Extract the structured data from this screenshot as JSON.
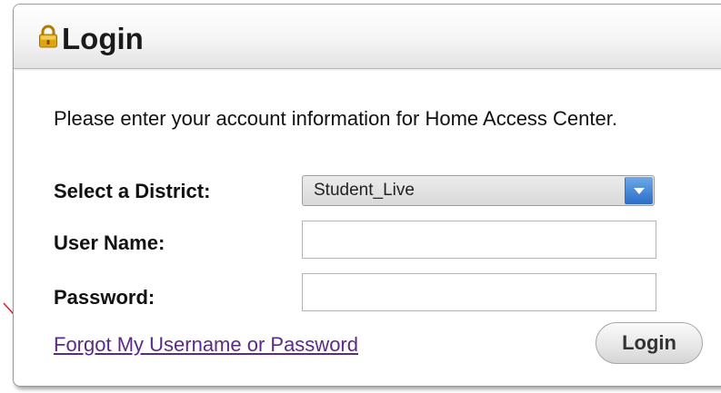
{
  "header": {
    "title": "Login",
    "icon": "lock-icon"
  },
  "intro_text": "Please enter your account information for Home Access Center.",
  "form": {
    "district_label": "Select a District:",
    "district_value": "Student_Live",
    "username_label": "User Name:",
    "username_value": "",
    "password_label": "Password:",
    "password_value": ""
  },
  "links": {
    "forgot": "Forgot My Username or Password"
  },
  "buttons": {
    "login": "Login"
  },
  "colors": {
    "link": "#5b2a86",
    "dropdown_accent": "#2a6cc7",
    "lock": "#e0a412",
    "annotation_arrow": "#d62020"
  }
}
